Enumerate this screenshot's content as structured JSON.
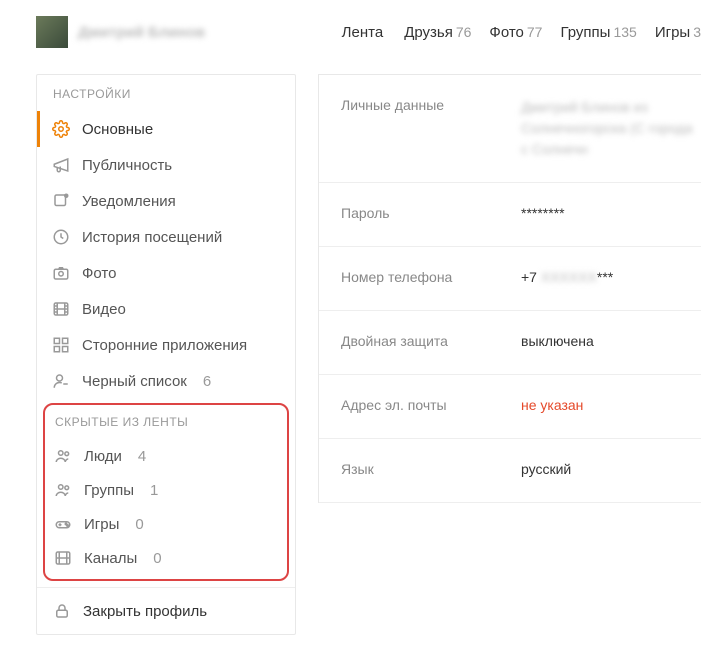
{
  "header": {
    "username": "Дмитрий Блинов",
    "nav": [
      {
        "label": "Лента",
        "count": ""
      },
      {
        "label": "Друзья",
        "count": "76"
      },
      {
        "label": "Фото",
        "count": "77"
      },
      {
        "label": "Группы",
        "count": "135"
      },
      {
        "label": "Игры",
        "count": "3"
      }
    ]
  },
  "sidebar": {
    "settings_title": "НАСТРОЙКИ",
    "items": [
      {
        "label": "Основные",
        "count": ""
      },
      {
        "label": "Публичность",
        "count": ""
      },
      {
        "label": "Уведомления",
        "count": ""
      },
      {
        "label": "История посещений",
        "count": ""
      },
      {
        "label": "Фото",
        "count": ""
      },
      {
        "label": "Видео",
        "count": ""
      },
      {
        "label": "Сторонние приложения",
        "count": ""
      },
      {
        "label": "Черный список",
        "count": "6"
      }
    ],
    "hidden_title": "СКРЫТЫЕ ИЗ ЛЕНТЫ",
    "hidden": [
      {
        "label": "Люди",
        "count": "4"
      },
      {
        "label": "Группы",
        "count": "1"
      },
      {
        "label": "Игры",
        "count": "0"
      },
      {
        "label": "Каналы",
        "count": "0"
      }
    ],
    "close_profile": "Закрыть профиль"
  },
  "content": {
    "rows": [
      {
        "key": "Личные данные",
        "val": "Дмитрий Блинов из Солнечногорска (С города с Солнечн"
      },
      {
        "key": "Пароль",
        "val": "********"
      },
      {
        "key": "Номер телефона",
        "val": "+7 ХХХХХХ***"
      },
      {
        "key": "Двойная защита",
        "val": "выключена"
      },
      {
        "key": "Адрес эл. почты",
        "val": "не указан"
      },
      {
        "key": "Язык",
        "val": "русский"
      }
    ]
  }
}
